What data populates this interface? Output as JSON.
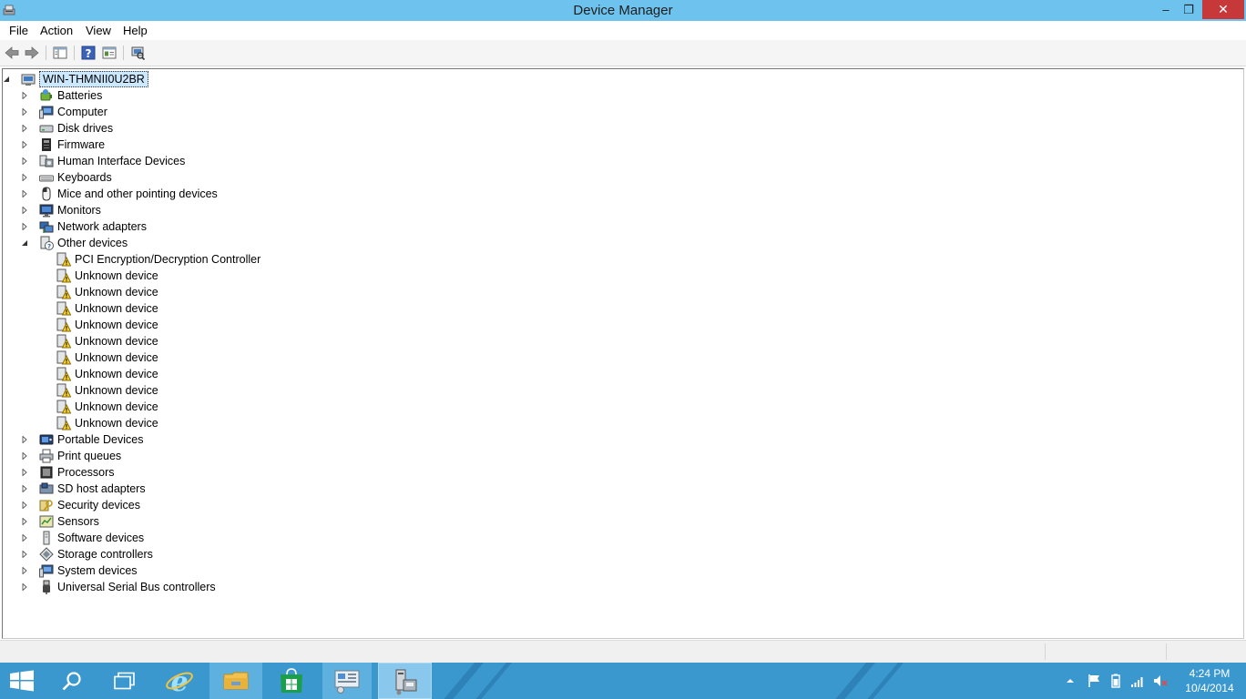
{
  "window": {
    "title": "Device Manager",
    "minimize": "‒",
    "maximize": "❐",
    "close": "✕"
  },
  "menu": [
    "File",
    "Action",
    "View",
    "Help"
  ],
  "toolbar": [
    "back-icon",
    "forward-icon",
    "show-hide-console-tree-icon",
    "help-icon",
    "properties-icon",
    "scan-hardware-icon"
  ],
  "tree": {
    "root": "WIN-THMNII0U2BR",
    "categories_before": [
      {
        "label": "Batteries",
        "icon": "battery-icon"
      },
      {
        "label": "Computer",
        "icon": "computer-icon"
      },
      {
        "label": "Disk drives",
        "icon": "disk-drive-icon"
      },
      {
        "label": "Firmware",
        "icon": "firmware-icon"
      },
      {
        "label": "Human Interface Devices",
        "icon": "hid-icon"
      },
      {
        "label": "Keyboards",
        "icon": "keyboard-icon"
      },
      {
        "label": "Mice and other pointing devices",
        "icon": "mouse-icon"
      },
      {
        "label": "Monitors",
        "icon": "monitor-icon"
      },
      {
        "label": "Network adapters",
        "icon": "network-adapter-icon"
      }
    ],
    "expanded": {
      "label": "Other devices",
      "icon": "other-devices-icon",
      "children": [
        "PCI Encryption/Decryption Controller",
        "Unknown device",
        "Unknown device",
        "Unknown device",
        "Unknown device",
        "Unknown device",
        "Unknown device",
        "Unknown device",
        "Unknown device",
        "Unknown device",
        "Unknown device"
      ]
    },
    "categories_after": [
      {
        "label": "Portable Devices",
        "icon": "portable-device-icon"
      },
      {
        "label": "Print queues",
        "icon": "printer-icon"
      },
      {
        "label": "Processors",
        "icon": "processor-icon"
      },
      {
        "label": "SD host adapters",
        "icon": "sd-adapter-icon"
      },
      {
        "label": "Security devices",
        "icon": "security-device-icon"
      },
      {
        "label": "Sensors",
        "icon": "sensor-icon"
      },
      {
        "label": "Software devices",
        "icon": "software-device-icon"
      },
      {
        "label": "Storage controllers",
        "icon": "storage-controller-icon"
      },
      {
        "label": "System devices",
        "icon": "system-device-icon"
      },
      {
        "label": "Universal Serial Bus controllers",
        "icon": "usb-icon"
      }
    ]
  },
  "taskbar": {
    "apps": [
      "start-icon",
      "search-icon",
      "task-view-icon",
      "internet-explorer-icon",
      "file-explorer-icon",
      "store-icon",
      "control-panel-icon",
      "device-manager-icon"
    ],
    "time": "4:24 PM",
    "date": "10/4/2014"
  },
  "colors": {
    "titlebar": "#6dc2ee",
    "close": "#c7383b",
    "taskbar": "#3a98cf",
    "selection": "#cce8ff"
  }
}
